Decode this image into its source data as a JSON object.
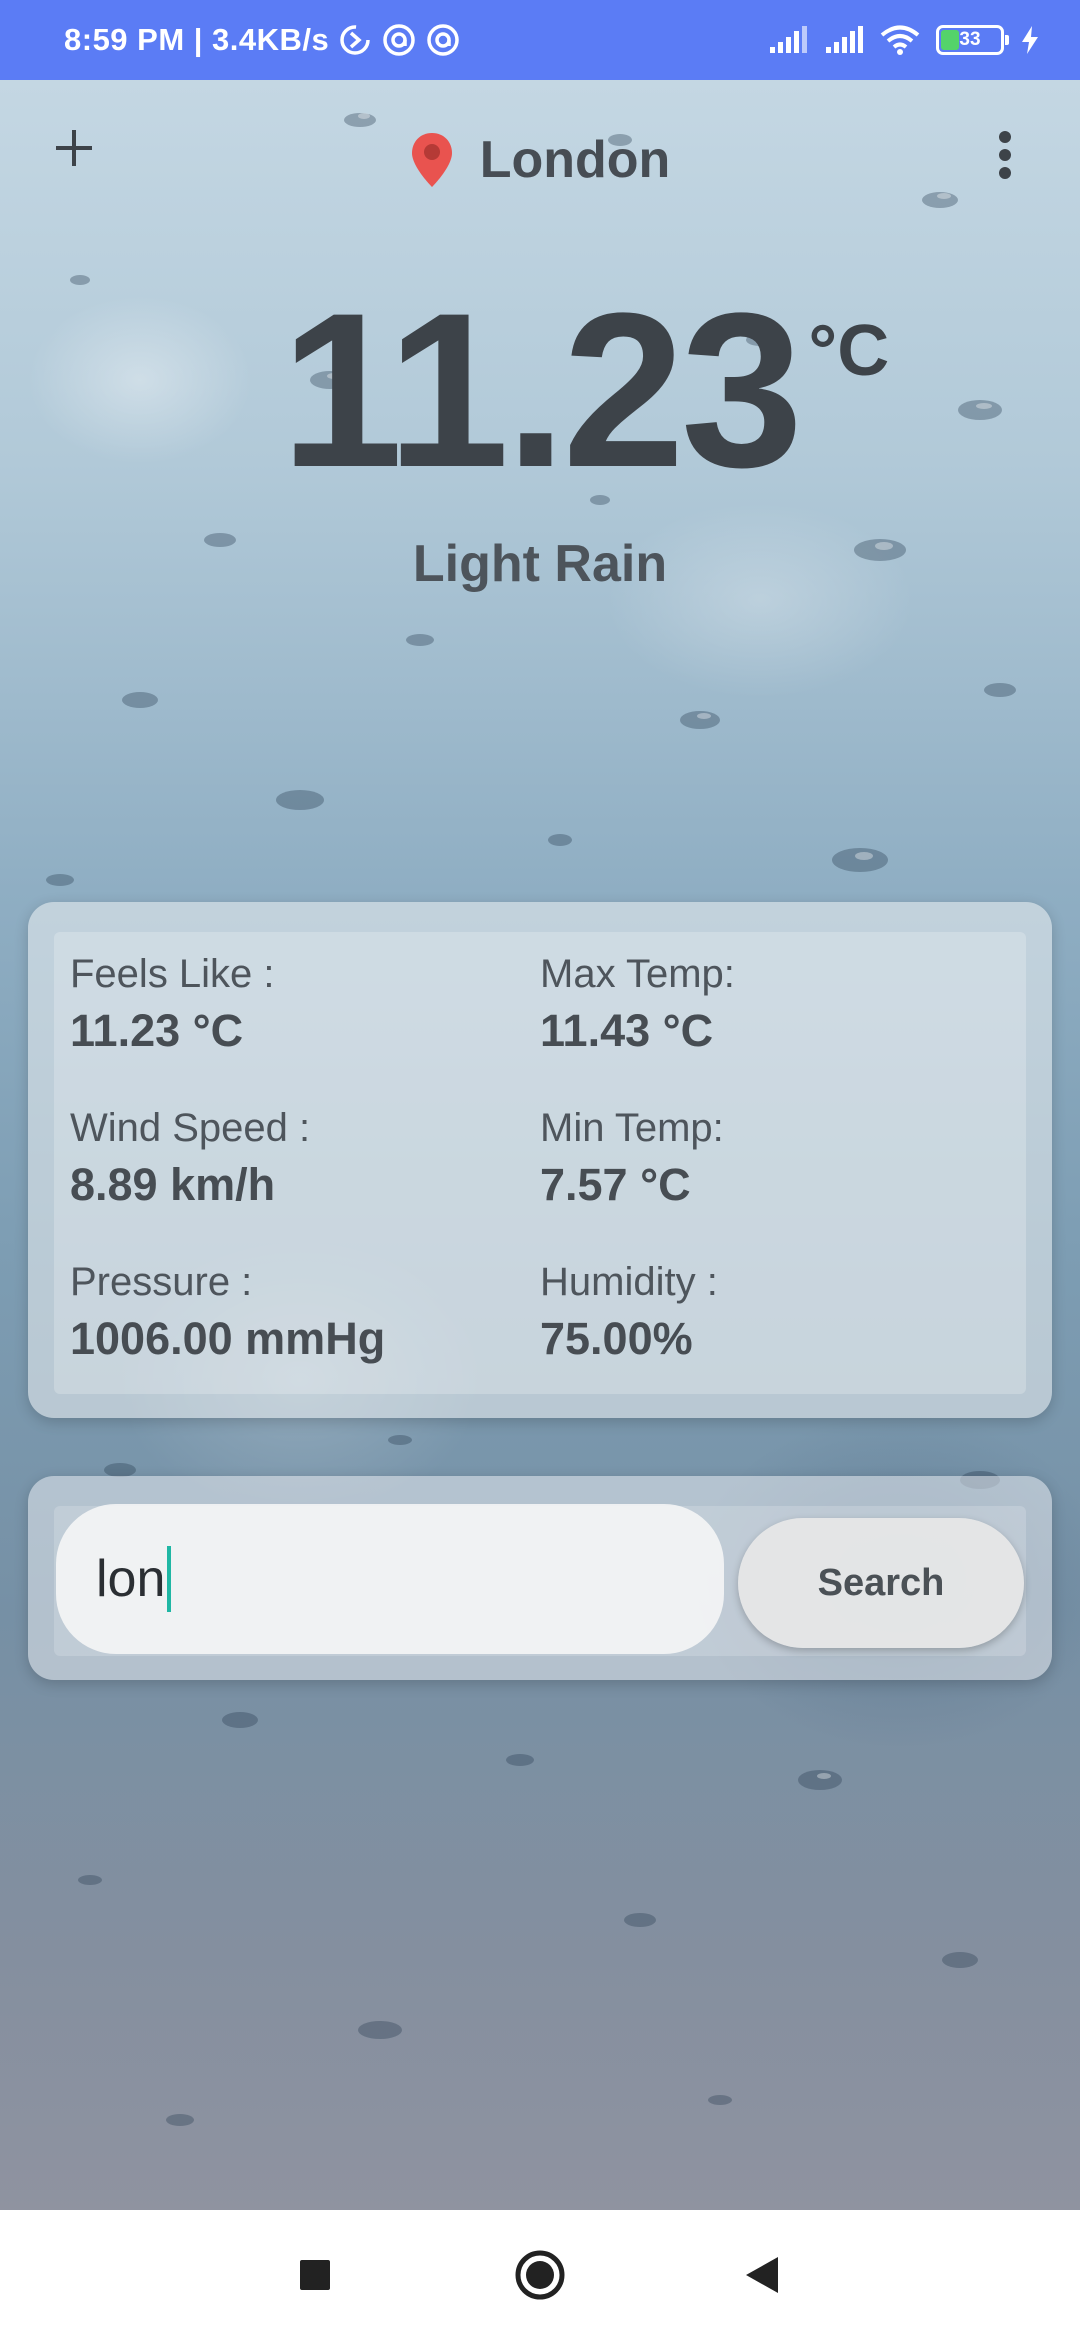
{
  "status_bar": {
    "time": "8:59 PM | 3.4KB/s",
    "battery": "33"
  },
  "header": {
    "city": "London"
  },
  "weather": {
    "temperature": "11.23",
    "unit": "°C",
    "condition": "Light Rain"
  },
  "details": {
    "feels_like_label": "Feels Like :",
    "feels_like_value": "11.23 °C",
    "max_temp_label": "Max Temp:",
    "max_temp_value": "11.43 °C",
    "wind_speed_label": "Wind Speed :",
    "wind_speed_value": "8.89 km/h",
    "min_temp_label": "Min Temp:",
    "min_temp_value": "7.57 °C",
    "pressure_label": "Pressure :",
    "pressure_value": "1006.00 mmHg",
    "humidity_label": "Humidity :",
    "humidity_value": "75.00%"
  },
  "search": {
    "input_value": "lon",
    "button_label": "Search"
  },
  "icons": {
    "add": "plus-icon",
    "location": "location-pin-icon",
    "menu": "more-vert-icon",
    "nav_recents": "square-icon",
    "nav_home": "circle-icon",
    "nav_back": "triangle-back-icon"
  },
  "colors": {
    "status_bar": "#5b7cf5",
    "pin": "#e9534f",
    "text_dark": "#3d4349",
    "caret": "#1fb7a4"
  }
}
